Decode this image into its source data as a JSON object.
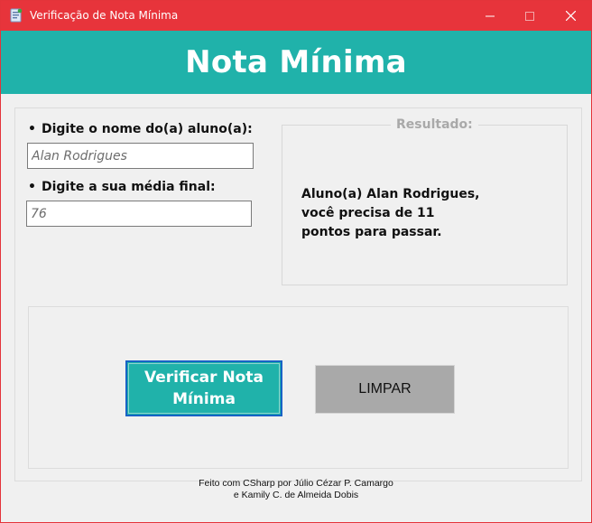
{
  "window": {
    "title": "Verificação de Nota Mínima",
    "accent_color": "#e7343b"
  },
  "header": {
    "title": "Nota Mínima",
    "background": "#20b2aa"
  },
  "form": {
    "name_label": "Digite o nome do(a) aluno(a):",
    "name_value": "Alan Rodrigues",
    "average_label": "Digite a sua média final:",
    "average_value": "76",
    "bullet": "•"
  },
  "result": {
    "legend": "Resultado:",
    "message": "Aluno(a) Alan Rodrigues, você precisa de 11 pontos para passar."
  },
  "buttons": {
    "verify_label": "Verificar Nota Mínima",
    "clear_label": "LIMPAR"
  },
  "footer": {
    "line1": "Feito com CSharp por Júlio Cézar P. Camargo",
    "line2": "e Kamily C. de Almeida Dobis"
  },
  "icons": {
    "app": "app-icon",
    "minimize": "minimize-icon",
    "maximize": "maximize-icon",
    "close": "close-icon"
  }
}
